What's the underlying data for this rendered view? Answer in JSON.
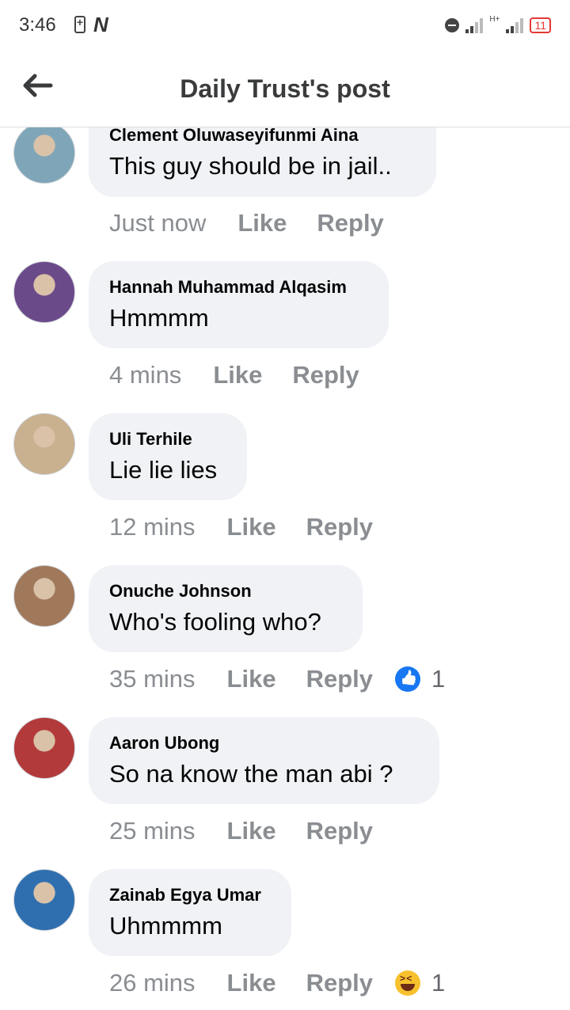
{
  "status_bar": {
    "time": "3:46",
    "battery_level": "11"
  },
  "header": {
    "title": "Daily Trust's post"
  },
  "actions": {
    "like_label": "Like",
    "reply_label": "Reply"
  },
  "comments": [
    {
      "name": "Clement Oluwaseyifunmi Aina",
      "text": "This guy should be in jail..",
      "time": "Just now",
      "avatar_color": "#7fa6b8",
      "reaction_icon": "",
      "reaction_count": ""
    },
    {
      "name": "Hannah Muhammad Alqasim",
      "text": "Hmmmm",
      "time": "4 mins",
      "avatar_color": "#6b4a8a",
      "reaction_icon": "",
      "reaction_count": ""
    },
    {
      "name": "Uli Terhile",
      "text": "Lie lie lies",
      "time": "12 mins",
      "avatar_color": "#c9b08f",
      "reaction_icon": "",
      "reaction_count": ""
    },
    {
      "name": "Onuche Johnson",
      "text": "Who's fooling who?",
      "time": "35 mins",
      "avatar_color": "#a0785a",
      "reaction_icon": "like-reaction-icon",
      "reaction_count": "1"
    },
    {
      "name": "Aaron Ubong",
      "text": "So na know the man abi ?",
      "time": "25 mins",
      "avatar_color": "#b33a3a",
      "reaction_icon": "",
      "reaction_count": ""
    },
    {
      "name": "Zainab Egya Umar",
      "text": "Uhmmmm",
      "time": "26 mins",
      "avatar_color": "#2f6fb0",
      "reaction_icon": "haha-reaction-icon",
      "reaction_count": "1"
    }
  ],
  "colors": {
    "bubble": "#f0f2f5",
    "meta_text": "#8a8d91",
    "like_blue": "#1877f2"
  }
}
